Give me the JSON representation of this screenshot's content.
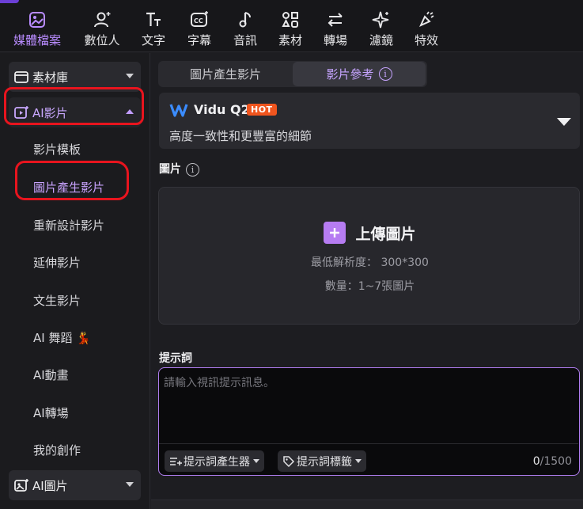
{
  "toolbar": {
    "items": [
      {
        "label": "媒體檔案",
        "icon": "media-icon",
        "active": true
      },
      {
        "label": "數位人",
        "icon": "avatar-person-icon"
      },
      {
        "label": "文字",
        "icon": "text-icon"
      },
      {
        "label": "字幕",
        "icon": "captions-icon"
      },
      {
        "label": "音訊",
        "icon": "music-note-icon"
      },
      {
        "label": "素材",
        "icon": "elements-icon"
      },
      {
        "label": "轉場",
        "icon": "transition-icon"
      },
      {
        "label": "濾鏡",
        "icon": "sparkle-icon"
      },
      {
        "label": "特效",
        "icon": "effects-icon"
      }
    ],
    "active_color": "#b98cff"
  },
  "sidebar": {
    "groups": {
      "library": {
        "label": "素材庫",
        "icon": "folder-icon"
      },
      "ai_video": {
        "label": "AI影片",
        "icon": "ai-video-icon",
        "expanded": true
      },
      "ai_image": {
        "label": "AI圖片",
        "icon": "ai-image-icon"
      }
    },
    "sub_items": [
      {
        "label": "影片模板"
      },
      {
        "label": "圖片產生影片",
        "active": true
      },
      {
        "label": "重新設計影片"
      },
      {
        "label": "延伸影片"
      },
      {
        "label": "文生影片"
      },
      {
        "label": "AI 舞蹈",
        "emoji": "💃"
      },
      {
        "label": "AI動畫"
      },
      {
        "label": "AI轉場"
      },
      {
        "label": "我的創作"
      }
    ]
  },
  "main": {
    "tabs": [
      {
        "label": "圖片產生影片"
      },
      {
        "label": "影片參考",
        "active": true,
        "has_info": true
      }
    ],
    "model": {
      "name": "Vidu Q2",
      "badge": "HOT",
      "description": "高度一致性和更豐富的細節"
    },
    "image_section": {
      "label": "圖片",
      "upload_label": "上傳圖片",
      "min_resolution": "最低解析度： 300*300",
      "quantity": "數量：1~7張圖片"
    },
    "prompt": {
      "label": "提示詞",
      "placeholder": "請輸入視訊提示訊息。",
      "generator_label": "提示詞產生器",
      "tags_label": "提示詞標籤",
      "count": "0",
      "max": "/1500"
    }
  },
  "colors": {
    "accent": "#b67cf2",
    "annotation": "#e8141e",
    "hot_badge": "#f0551e"
  }
}
